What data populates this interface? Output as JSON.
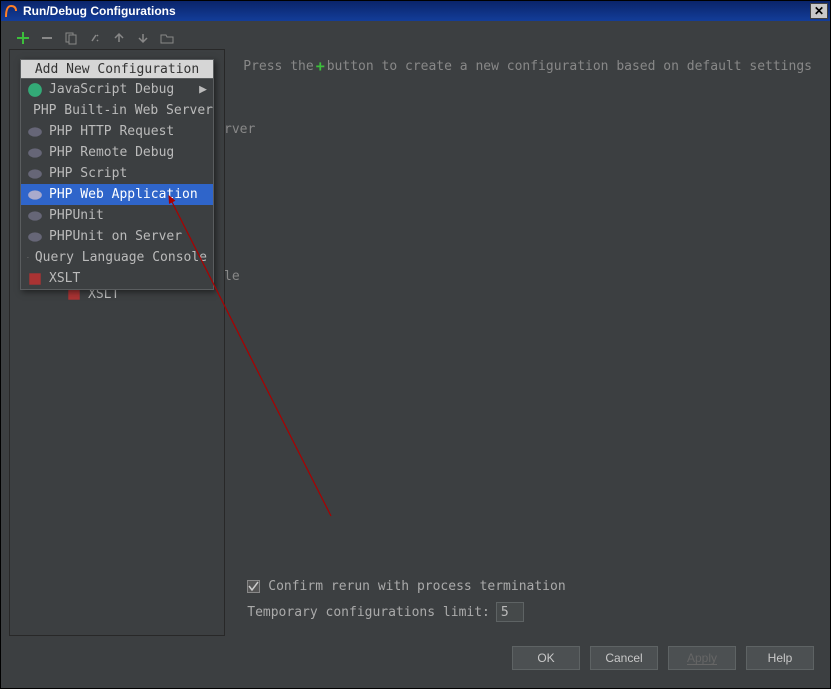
{
  "window": {
    "title": "Run/Debug Configurations"
  },
  "toolbar": {
    "icons": [
      "plus",
      "minus",
      "copy",
      "wrench",
      "up",
      "down",
      "folder"
    ]
  },
  "popup": {
    "header": "Add New Configuration",
    "items": [
      {
        "label": "JavaScript Debug",
        "icon": "js",
        "submenu": true
      },
      {
        "label": "PHP Built-in Web Server",
        "icon": "php"
      },
      {
        "label": "PHP HTTP Request",
        "icon": "php"
      },
      {
        "label": "PHP Remote Debug",
        "icon": "php"
      },
      {
        "label": "PHP Script",
        "icon": "php"
      },
      {
        "label": "PHP Web Application",
        "icon": "php",
        "selected": true
      },
      {
        "label": "PHPUnit",
        "icon": "php"
      },
      {
        "label": "PHPUnit on Server",
        "icon": "php"
      },
      {
        "label": "Query Language Console",
        "icon": "db"
      },
      {
        "label": "XSLT",
        "icon": "xslt"
      }
    ]
  },
  "tree": {
    "behind_server": "rver",
    "behind_le": "le",
    "xslt_item": "XSLT"
  },
  "hint": {
    "pre": "Press the",
    "post": " button to create a new configuration based on default settings"
  },
  "confirm_rerun": "Confirm rerun with process termination",
  "temp_limit_label": "Temporary configurations limit:",
  "temp_limit_value": "5",
  "buttons": {
    "ok": "OK",
    "cancel": "Cancel",
    "apply": "Apply",
    "help": "Help"
  }
}
